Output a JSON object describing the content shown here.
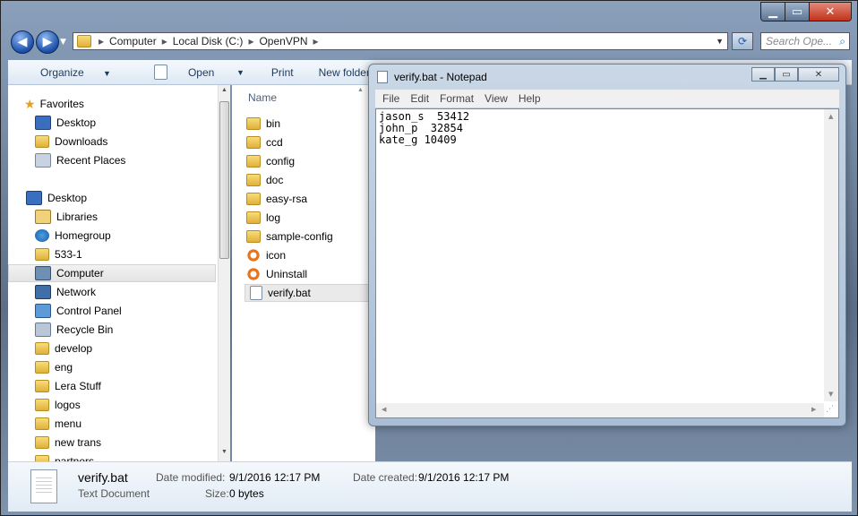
{
  "explorer": {
    "address": {
      "segments": [
        "Computer",
        "Local Disk (C:)",
        "OpenVPN"
      ]
    },
    "search_placeholder": "Search Ope...",
    "toolbar": {
      "organize": "Organize",
      "open": "Open",
      "print": "Print",
      "new_folder": "New folder"
    },
    "nav": {
      "items": [
        {
          "label": "Favorites",
          "icon": "star-icon"
        },
        {
          "label": "Desktop",
          "icon": "desktop-icon"
        },
        {
          "label": "Downloads",
          "icon": "downloads-icon"
        },
        {
          "label": "Recent Places",
          "icon": "recent-places-icon"
        },
        {
          "label": "Desktop",
          "icon": "desktop-icon"
        },
        {
          "label": "Libraries",
          "icon": "libraries-icon"
        },
        {
          "label": "Homegroup",
          "icon": "homegroup-icon"
        },
        {
          "label": "533-1",
          "icon": "user-folder-icon"
        },
        {
          "label": "Computer",
          "icon": "computer-icon"
        },
        {
          "label": "Network",
          "icon": "network-icon"
        },
        {
          "label": "Control Panel",
          "icon": "control-panel-icon"
        },
        {
          "label": "Recycle Bin",
          "icon": "recycle-bin-icon"
        },
        {
          "label": "develop",
          "icon": "folder-icon"
        },
        {
          "label": "eng",
          "icon": "folder-icon"
        },
        {
          "label": "Lera Stuff",
          "icon": "folder-icon"
        },
        {
          "label": "logos",
          "icon": "folder-icon"
        },
        {
          "label": "menu",
          "icon": "folder-icon"
        },
        {
          "label": "new trans",
          "icon": "folder-icon"
        },
        {
          "label": "partners",
          "icon": "folder-icon"
        }
      ]
    },
    "column_header": "Name",
    "files": [
      {
        "name": "bin",
        "icon": "folder-icon"
      },
      {
        "name": "ccd",
        "icon": "folder-icon"
      },
      {
        "name": "config",
        "icon": "folder-icon"
      },
      {
        "name": "doc",
        "icon": "folder-icon"
      },
      {
        "name": "easy-rsa",
        "icon": "folder-icon"
      },
      {
        "name": "log",
        "icon": "folder-icon"
      },
      {
        "name": "sample-config",
        "icon": "folder-icon"
      },
      {
        "name": "icon",
        "icon": "openvpn-icon"
      },
      {
        "name": "Uninstall",
        "icon": "openvpn-icon"
      },
      {
        "name": "verify.bat",
        "icon": "text-file-icon"
      }
    ],
    "details": {
      "name": "verify.bat",
      "type": "Text Document",
      "modified_label": "Date modified:",
      "modified_value": "9/1/2016 12:17 PM",
      "created_label": "Date created:",
      "created_value": "9/1/2016 12:17 PM",
      "size_label": "Size:",
      "size_value": "0 bytes"
    }
  },
  "notepad": {
    "title": "verify.bat - Notepad",
    "menu": [
      "File",
      "Edit",
      "Format",
      "View",
      "Help"
    ],
    "lines": [
      "jason_s  53412",
      "john_p  32854",
      "kate_g 10409"
    ]
  }
}
